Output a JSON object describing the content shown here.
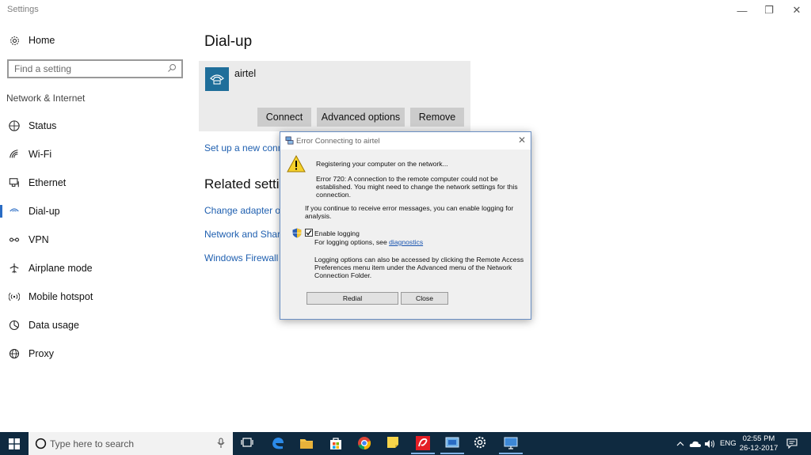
{
  "window": {
    "title": "Settings",
    "controls": {
      "minimize": "—",
      "restore": "❐",
      "close": "✕"
    }
  },
  "sidebar": {
    "home_label": "Home",
    "search_placeholder": "Find a setting",
    "section": "Network & Internet",
    "items": [
      {
        "label": "Status",
        "icon": "status-icon"
      },
      {
        "label": "Wi-Fi",
        "icon": "wifi-icon"
      },
      {
        "label": "Ethernet",
        "icon": "ethernet-icon"
      },
      {
        "label": "Dial-up",
        "icon": "dialup-icon",
        "active": true
      },
      {
        "label": "VPN",
        "icon": "vpn-icon"
      },
      {
        "label": "Airplane mode",
        "icon": "airplane-icon"
      },
      {
        "label": "Mobile hotspot",
        "icon": "hotspot-icon"
      },
      {
        "label": "Data usage",
        "icon": "data-usage-icon"
      },
      {
        "label": "Proxy",
        "icon": "globe-icon"
      }
    ]
  },
  "main": {
    "title": "Dial-up",
    "connection": {
      "name": "airtel",
      "buttons": {
        "connect": "Connect",
        "advanced": "Advanced options",
        "remove": "Remove"
      }
    },
    "setup_link": "Set up a new connection",
    "related_title": "Related settings",
    "related_links": [
      "Change adapter options",
      "Network and Sharing Center",
      "Windows Firewall"
    ]
  },
  "dialog": {
    "title": "Error Connecting to airtel",
    "status": "Registering your computer on the network...",
    "error_line1": "Error 720: A connection to the remote computer could not be",
    "error_line2": "established.  You might need to change the network settings for this",
    "error_line3": "connection.",
    "logging_hint_line1": "If you continue to receive error messages, you can enable logging for",
    "logging_hint_line2": "analysis.",
    "checkbox_label": "Enable logging",
    "checkbox_checked": true,
    "options_text": "For logging options, see ",
    "options_link": "diagnostics",
    "access_line1": "Logging options can also be accessed by clicking the Remote Access",
    "access_line2": "Preferences menu item under the Advanced menu of the Network",
    "access_line3": "Connection Folder.",
    "buttons": {
      "redial": "Redial",
      "close": "Close"
    }
  },
  "taskbar": {
    "search_placeholder": "Type here to search",
    "language": "ENG",
    "time": "02:55 PM",
    "date": "26-12-2017"
  },
  "colors": {
    "accent": "#2a6cc4",
    "taskbar": "#0f2a40",
    "card_bg": "#ebebeb",
    "button_bg": "#cccccc",
    "link": "#2060b0"
  }
}
